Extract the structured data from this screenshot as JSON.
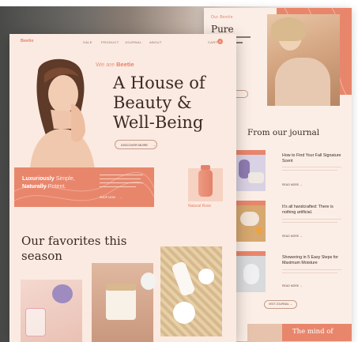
{
  "front": {
    "nav": {
      "logo": "Beetie",
      "items": [
        "SALE",
        "PRODUCT",
        "JOURNAL",
        "ABOUT"
      ],
      "cart": "CART",
      "cart_count": "0"
    },
    "hero": {
      "eyebrow_prefix": "We are ",
      "eyebrow_brand": "Beetie",
      "title_line1": "A House of",
      "title_line2": "Beauty &",
      "title_line3": "Well-Being",
      "cta": "DISCOVER MORE",
      "cta_arrow": "→"
    },
    "banner": {
      "line1_bold": "Luxuriously",
      "line1_light": " Simple,",
      "line2_bold": "Naturally",
      "line2_light": " Potent.",
      "shop_now": "SHOP NOW",
      "arrow": "→"
    },
    "product_label": "Natural Rose",
    "favorites_title_line1": "Our favorites this",
    "favorites_title_line2": "season"
  },
  "back": {
    "brand": "Our Beetie",
    "pure": "Pure",
    "journal_title": "From our journal",
    "articles": [
      {
        "title": "How to Find Your Fall Signature Scent",
        "read": "READ MORE →"
      },
      {
        "title": "It's all handcrafted: There is nothing artificial.",
        "read": "READ MORE →"
      },
      {
        "title": "Showering in 5 Easy Steps for Maximum Moisture",
        "read": "READ MORE →"
      }
    ],
    "visit": "VISIT JOURNAL →",
    "mind": "The mind of"
  },
  "colors": {
    "accent": "#e8866c",
    "panel": "#fbeae1",
    "text_dark": "#3b2a24"
  }
}
